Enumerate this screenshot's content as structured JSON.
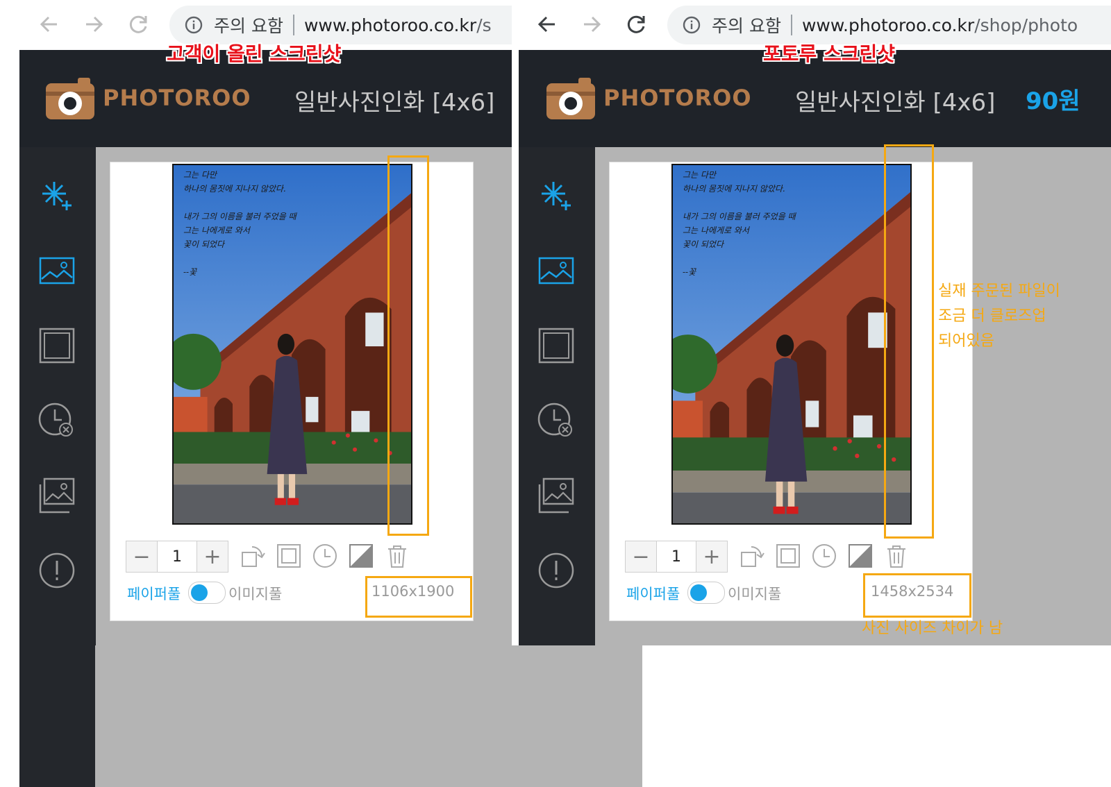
{
  "left": {
    "caption": "고객이 올린 스크린샷",
    "browser": {
      "warning": "주의 요함",
      "url_domain": "www.photoroo.co.kr",
      "url_path": "/s"
    },
    "app": {
      "brand": "PHOTOROO",
      "product": "일반사진인화 [4x6]"
    },
    "quantity": "1",
    "paper_label": "페이퍼풀",
    "image_label": "이미지풀",
    "dimensions": "1106x1900"
  },
  "right": {
    "caption": "포토루 스크린샷",
    "browser": {
      "warning": "주의 요함",
      "url_domain": "www.photoroo.co.kr",
      "url_path": "/shop/photo"
    },
    "app": {
      "brand": "PHOTOROO",
      "product": "일반사진인화 [4x6]",
      "price": "90원"
    },
    "quantity": "1",
    "paper_label": "페이퍼풀",
    "image_label": "이미지풀",
    "dimensions": "1458x2534",
    "note_closeup": "실재 주문된 파일이\n조금 더 클로즈업\n되어있음",
    "note_size": "사진 사이즈 차이가 남"
  },
  "poem": "그는 다만\n하나의 몸짓에 지나지 않았다.\n\n내가 그의 이름을 불러 주었을 때\n그는 나에게로 와서\n꽃이 되었다\n\n--꽃",
  "colors": {
    "header_bg": "#1f2329",
    "sidebar_bg": "#24272c",
    "workspace_bg": "#b4b4b4",
    "brand": "#b57c4c",
    "accent": "#1aa3e8",
    "caption": "#e8101a",
    "highlight": "#f5a812"
  },
  "icons": {
    "nav": [
      "back-arrow-icon",
      "forward-arrow-icon",
      "reload-icon",
      "info-icon"
    ],
    "sidebar": [
      "effects-sparkle-icon",
      "image-icon",
      "frame-square-icon",
      "history-clear-icon",
      "gallery-icon",
      "alert-icon"
    ],
    "tools": [
      "rotate-icon",
      "crop-square-icon",
      "clock-icon",
      "contrast-icon",
      "trash-icon"
    ]
  }
}
